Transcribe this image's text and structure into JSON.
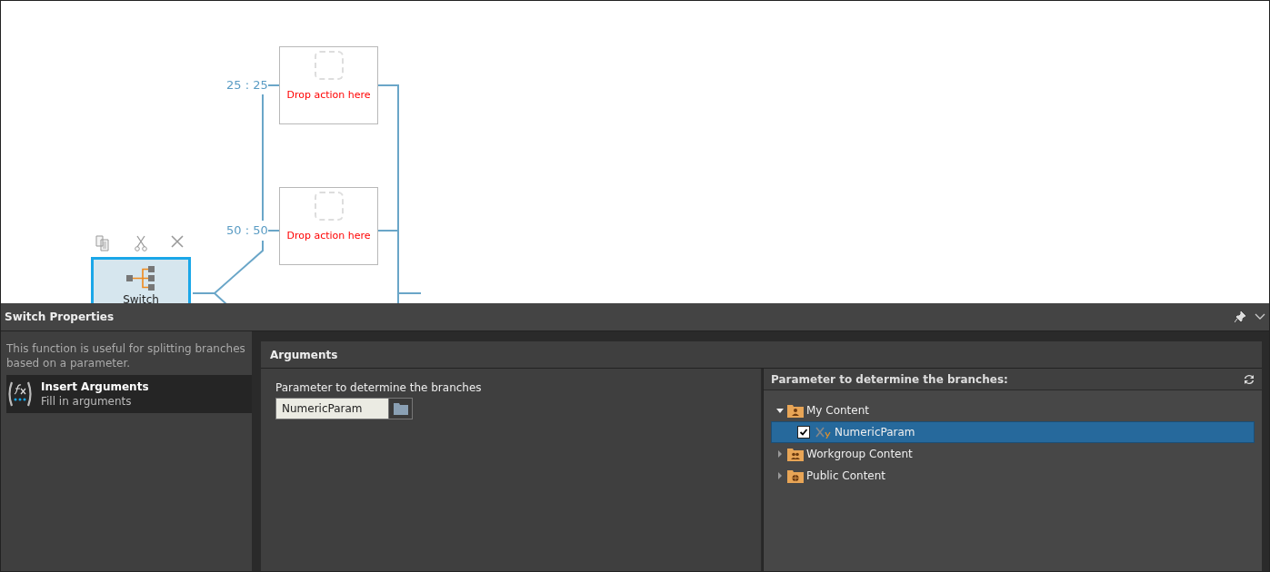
{
  "canvas": {
    "branches": [
      {
        "label": "25 : 25",
        "placeholder": "Drop action here"
      },
      {
        "label": "50 : 50",
        "placeholder": "Drop action here"
      }
    ],
    "switch_node": {
      "label": "Switch",
      "selected": true
    }
  },
  "panel": {
    "title": "Switch Properties",
    "description": "This function is useful for splitting branches based on a parameter.",
    "steps": [
      {
        "title": "Insert Arguments",
        "subtitle": "Fill in arguments",
        "selected": true
      }
    ],
    "arguments": {
      "title": "Arguments",
      "field_label": "Parameter to determine the branches",
      "field_value": "NumericParam"
    },
    "browser": {
      "title": "Parameter to determine the branches:",
      "tree": [
        {
          "label": "My Content",
          "kind": "personal",
          "expanded": true,
          "selected": false,
          "children": [
            {
              "label": "NumericParam",
              "kind": "parameter",
              "checked": true,
              "selected": true
            }
          ]
        },
        {
          "label": "Workgroup Content",
          "kind": "workgroup",
          "expanded": false,
          "selected": false
        },
        {
          "label": "Public Content",
          "kind": "public",
          "expanded": false,
          "selected": false
        }
      ]
    }
  }
}
